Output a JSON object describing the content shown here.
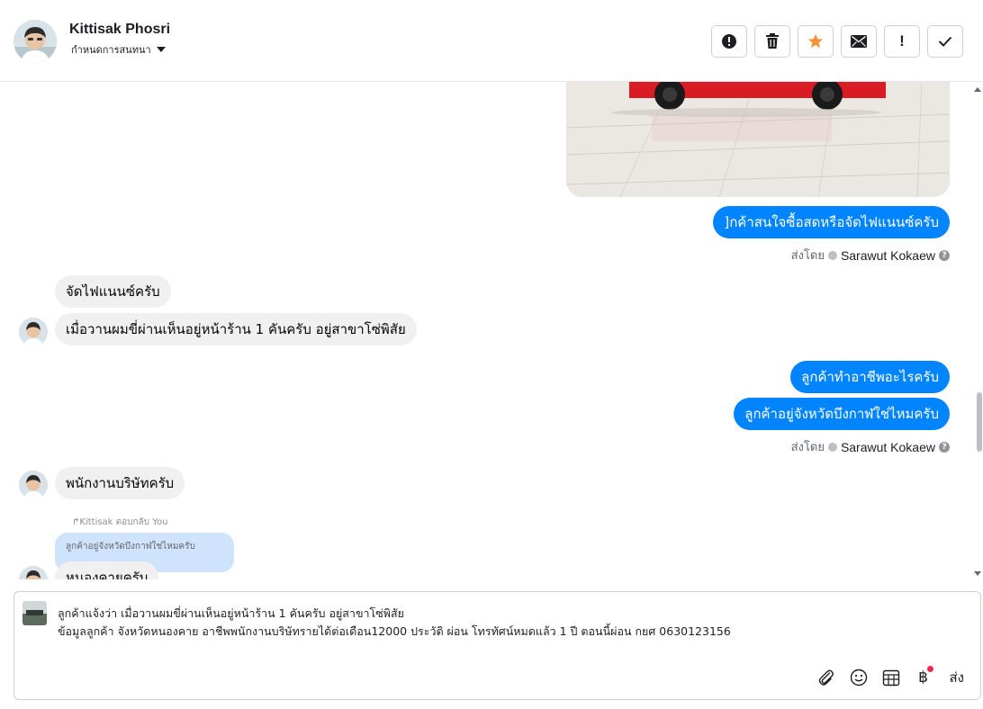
{
  "header": {
    "contact_name": "Kittisak Phosri",
    "conversation_label": "กำหนดการสนทนา",
    "actions": [
      {
        "name": "report",
        "label": "!"
      },
      {
        "name": "delete",
        "label": ""
      },
      {
        "name": "star",
        "label": ""
      },
      {
        "name": "mark-unread",
        "label": ""
      },
      {
        "name": "follow-up",
        "label": "!"
      },
      {
        "name": "mark-done",
        "label": ""
      }
    ]
  },
  "messages": {
    "out1": "]กค้าสนใจซื้อสดหรือจัดไฟแนนซ์ครับ",
    "sent_by_prefix": "ส่งโดย",
    "sent_by_name": "Sarawut Kokaew",
    "in1": "จัดไฟแนนซ์ครับ",
    "in2": "เมื่อวานผมขี่ผ่านเห็นอยู่หน้าร้าน 1 คันครับ อยู่สาขาโซ่พิสัย",
    "out2": "ลูกค้าทำอาชีพอะไรครับ",
    "out3": "ลูกค้าอยู่จังหวัดบึงกาฬใช่ไหมครับ",
    "in3": "พนักงานบริษัทครับ",
    "reply_label": "Kittisak ตอบกลับ You",
    "reply_quote": "ลูกค้าอยู่จังหวัดบึงกาฬใช่ไหมครับ",
    "in4": "หนองคายครับ"
  },
  "composer": {
    "line1": "ลูกค้าแจ้งว่า  เมื่อวานผมขี่ผ่านเห็นอยู่หน้าร้าน 1 คันครับ อยู่สาขาโซ่พิสัย",
    "line2": "ข้อมูลลูกค้า  จังหวัดหนองคาย อาชีพพนักงานบริษัทรายได้ต่อเดือน12000 ประวัติ ผ่อน โทรทัศน์หมดแล้ว 1 ปี  ตอนนี้ผ่อน กยศ 0630123156",
    "send_label": "ส่ง",
    "baht_symbol": "฿"
  },
  "colors": {
    "outgoing_bubble": "#0084ff",
    "incoming_bubble": "#f0f0f0",
    "star": "#f7923b"
  }
}
